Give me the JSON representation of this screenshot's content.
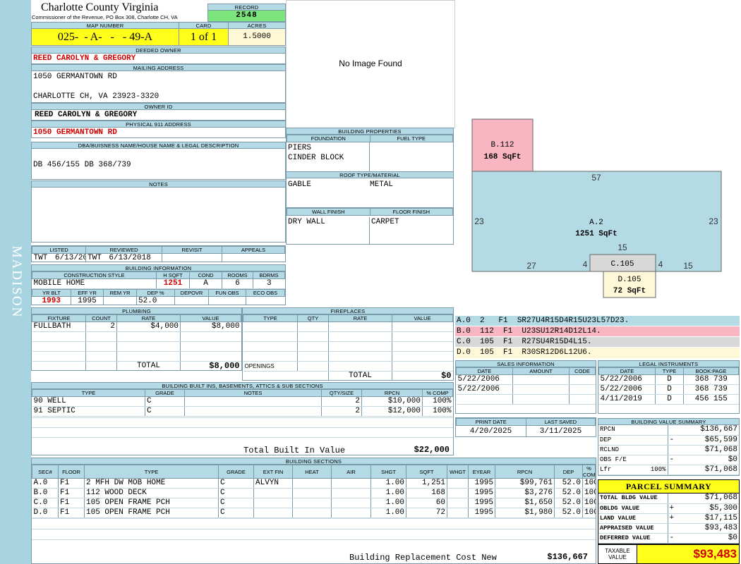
{
  "sidebar": {
    "label": "MADISON"
  },
  "header": {
    "county": "Charlotte County Virginia",
    "commissioner": "Commissioner of the Revenue, PO Box 308, Charlotte CH, VA",
    "record_label": "RECORD",
    "record_value": "2548",
    "map_label": "MAP NUMBER",
    "map_value": "025-  - A-   -   - 49-A",
    "card_label": "CARD",
    "card_value": "1 of 1",
    "acres_label": "ACRES",
    "acres_value": "1.5000"
  },
  "owner": {
    "deeded_label": "DEEDED OWNER",
    "deeded_value": "REED CAROLYN & GREGORY",
    "mailing_label": "MAILING ADDRESS",
    "mailing_line1": "1050 GERMANTOWN RD",
    "mailing_line2": "CHARLOTTE CH, VA 23923-3320",
    "owner_id_label": "OWNER ID",
    "owner_id_value": "REED CAROLYN & GREGORY",
    "physical_label": "PHYSICAL 911 ADDRESS",
    "physical_value": "1050 GERMANTOWN RD",
    "legal_label": "DBA/BUISNESS NAME/HOUSE NAME & LEGAL DESCRIPTION",
    "legal_value": "DB 456/155 DB 368/739",
    "notes_label": "NOTES"
  },
  "image": {
    "no_image": "No Image Found"
  },
  "listed": {
    "listed_label": "LISTED",
    "reviewed_label": "REVIEWED",
    "revisit_label": "REVISIT",
    "appeals_label": "APPEALS",
    "listed_by": "TWT",
    "listed_date": "6/13/2018",
    "reviewed_by": "TWT",
    "reviewed_date": "6/13/2018"
  },
  "building_info": {
    "title": "BUILDING INFORMATION",
    "style_label": "CONSTRUCTION STYLE",
    "hsqft_label": "H SQFT",
    "cond_label": "COND",
    "rooms_label": "ROOMS",
    "bdrms_label": "BDRMS",
    "style": "MOBILE HOME",
    "hsqft": "1251",
    "cond": "A",
    "rooms": "6",
    "bdrms": "3",
    "yrblt_label": "YR BLT",
    "effyr_label": "EFF YR",
    "remyr_label": "REM YR",
    "dep_label": "DEP %",
    "depovr_label": "DEPOVR",
    "funobs_label": "FUN OBS",
    "ecoobs_label": "ECO OBS",
    "yrblt": "1993",
    "effyr": "1995",
    "dep": "52.0"
  },
  "building_props": {
    "title": "BUILDING PROPERTIES",
    "foundation_label": "FOUNDATION",
    "fuel_label": "FUEL TYPE",
    "foundation1": "PIERS",
    "foundation2": "CINDER BLOCK",
    "roof_label": "ROOF TYPE/MATERIAL",
    "roof_type": "GABLE",
    "roof_material": "METAL",
    "wall_label": "WALL FINISH",
    "floor_label": "FLOOR FINISH",
    "wall": "DRY WALL",
    "floor": "CARPET"
  },
  "plumbing": {
    "title": "PLUMBING",
    "headers": [
      "FIXTURE",
      "COUNT",
      "RATE",
      "VALUE"
    ],
    "rows": [
      [
        "FULLBATH",
        "2",
        "$4,000",
        "$8,000"
      ]
    ],
    "total_label": "TOTAL",
    "total": "$8,000"
  },
  "fireplaces": {
    "title": "FIREPLACES",
    "headers": [
      "TYPE",
      "QTY",
      "RATE",
      "VALUE"
    ],
    "openings_label": "OPENINGS",
    "total_label": "TOTAL",
    "total": "$0"
  },
  "builtins": {
    "title": "BUILDING BUILT INS, BASEMENTS, ATTICS & SUB SECTIONS",
    "headers": [
      "TYPE",
      "GRADE",
      "NOTES",
      "QTY/SIZE",
      "RPCN",
      "% COMP"
    ],
    "rows": [
      [
        "90 WELL",
        "C",
        "",
        "2",
        "$10,000",
        "100%"
      ],
      [
        "91 SEPTIC",
        "C",
        "",
        "2",
        "$12,000",
        "100%"
      ]
    ],
    "total_label": "Total Built In Value",
    "total": "$22,000"
  },
  "sections": {
    "title": "BUILDING SECTIONS",
    "headers": [
      "SEC#",
      "FLOOR",
      "TYPE",
      "GRADE",
      "EXT FIN",
      "HEAT",
      "AIR",
      "SHGT",
      "SQFT",
      "WHGT",
      "EYEAR",
      "RPCN",
      "DEP",
      "% COMP"
    ],
    "rows": [
      [
        "A.0",
        "F1",
        "2 MFH DW MOB HOME",
        "C",
        "ALVYN",
        "",
        "",
        "1.00",
        "1,251",
        "",
        "1995",
        "$99,761",
        "52.0",
        "100%"
      ],
      [
        "B.0",
        "F1",
        "112 WOOD DECK",
        "C",
        "",
        "",
        "",
        "1.00",
        "168",
        "",
        "1995",
        "$3,276",
        "52.0",
        "100%"
      ],
      [
        "C.0",
        "F1",
        "105 OPEN FRAME PCH",
        "C",
        "",
        "",
        "",
        "1.00",
        "60",
        "",
        "1995",
        "$1,650",
        "52.0",
        "100%"
      ],
      [
        "D.0",
        "F1",
        "105 OPEN FRAME PCH",
        "C",
        "",
        "",
        "",
        "1.00",
        "72",
        "",
        "1995",
        "$1,980",
        "52.0",
        "100%"
      ]
    ],
    "total_label": "Building Replacement Cost New",
    "total": "$136,667"
  },
  "sketch": {
    "b_label": "B.112",
    "b_area": "168 SqFt",
    "a_label": "A.2",
    "a_area": "1251 SqFt",
    "c_label": "C.105",
    "d_label": "D.105",
    "d_area": "72 SqFt",
    "dim_top": "57",
    "dim_left": "23",
    "dim_right": "23",
    "dim_mid": "15",
    "dim_bl": "27",
    "dim_c_left": "4",
    "dim_c_right": "4",
    "dim_br": "15"
  },
  "sketch_legend": [
    {
      "text": "A.0  2   F1  SR27U4R15D4R15U23L57D23.",
      "color": "#b4dae6"
    },
    {
      "text": "B.0  112  F1  U23SU12R14D12L14.",
      "color": "#f7b6c2"
    },
    {
      "text": "C.0  105  F1  R27SU4R15D4L15.",
      "color": "#d8d8d8"
    },
    {
      "text": "D.0  105  F1  R30SR12D6L12U6.",
      "color": "#fff8d8"
    }
  ],
  "sales": {
    "title": "SALES INFORMATION",
    "headers": [
      "DATE",
      "AMOUNT",
      "CODE"
    ],
    "rows": [
      [
        "5/22/2006",
        "",
        ""
      ],
      [
        "5/22/2006",
        "",
        ""
      ]
    ]
  },
  "legal": {
    "title": "LEGAL INSTRUMENTS",
    "headers": [
      "DATE",
      "TYPE",
      "BOOK:PAGE"
    ],
    "rows": [
      [
        "5/22/2006",
        "D",
        "368 739"
      ],
      [
        "5/22/2006",
        "D",
        "368 739"
      ],
      [
        "4/11/2019",
        "D",
        "456 155"
      ]
    ]
  },
  "print": {
    "print_label": "PRINT DATE",
    "saved_label": "LAST SAVED",
    "print_date": "4/20/2025",
    "saved_date": "3/11/2025"
  },
  "value_summary": {
    "title": "BUILDING VALUE SUMMARY",
    "rows": [
      {
        "label": "RPCN",
        "sign": "",
        "value": "$136,667"
      },
      {
        "label": "DEP",
        "sign": "-",
        "value": "$65,599"
      },
      {
        "label": "RCLND",
        "sign": "",
        "value": "$71,068"
      },
      {
        "label": "OBS F/E",
        "sign": "-",
        "value": "$0"
      },
      {
        "label": "Lfr",
        "pct": "100%",
        "sign": "",
        "value": "$71,068"
      }
    ]
  },
  "parcel": {
    "title": "PARCEL SUMMARY",
    "rows": [
      {
        "label": "TOTAL BLDG VALUE",
        "sign": "",
        "value": "$71,068"
      },
      {
        "label": "OBLDG VALUE",
        "sign": "+",
        "value": "$5,300"
      },
      {
        "label": "LAND VALUE",
        "sign": "+",
        "value": "$17,115"
      },
      {
        "label": "APPRAISED VALUE",
        "sign": "",
        "value": "$93,483"
      },
      {
        "label": "DEFERRED VALUE",
        "sign": "-",
        "value": "$0"
      }
    ],
    "taxable_label1": "TAXABLE",
    "taxable_label2": "VALUE",
    "taxable_value": "$93,483"
  }
}
